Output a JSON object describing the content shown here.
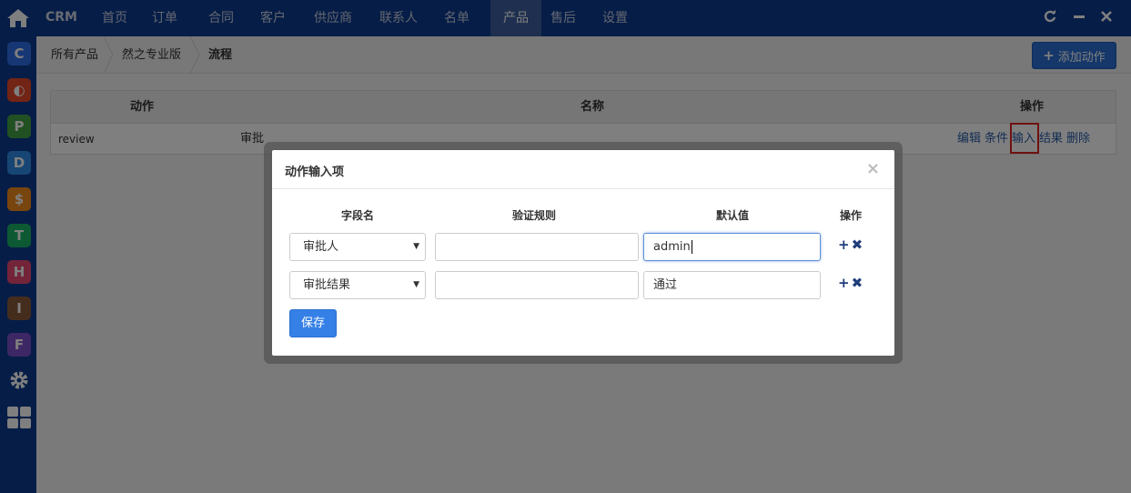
{
  "nav": {
    "brand": "CRM",
    "items": [
      "首页",
      "订单",
      "合同",
      "客户",
      "供应商",
      "联系人",
      "名单",
      "产品",
      "售后",
      "设置"
    ],
    "active_index": 7
  },
  "window_controls": {
    "refresh": "refresh-icon",
    "minimize": "minimize-icon",
    "close": "close-icon"
  },
  "sidebar_apps": [
    {
      "letter": "C",
      "color": "#2f6fe8"
    },
    {
      "letter": "◐",
      "color": "#e5482b"
    },
    {
      "letter": "P",
      "color": "#43a047"
    },
    {
      "letter": "D",
      "color": "#2f8de8"
    },
    {
      "letter": "$",
      "color": "#f08a1c"
    },
    {
      "letter": "T",
      "color": "#18b368"
    },
    {
      "letter": "H",
      "color": "#e84872"
    },
    {
      "letter": "I",
      "color": "#8b5a3c"
    },
    {
      "letter": "F",
      "color": "#7b4fc9"
    }
  ],
  "breadcrumb": [
    "所有产品",
    "然之专业版",
    "流程"
  ],
  "toolbar": {
    "add_action": "添加动作"
  },
  "table": {
    "headers": {
      "action": "动作",
      "name": "名称",
      "ops": "操作"
    },
    "rows": [
      {
        "action": "review",
        "name": "审批",
        "ops": [
          "编辑",
          "条件",
          "输入",
          "结果",
          "删除"
        ]
      }
    ]
  },
  "modal": {
    "title": "动作输入项",
    "close": "×",
    "columns": [
      "字段名",
      "验证规则",
      "默认值",
      "操作"
    ],
    "rows": [
      {
        "field": "审批人",
        "rule": "",
        "default": "admin"
      },
      {
        "field": "审批结果",
        "rule": "",
        "default": "通过"
      }
    ],
    "save": "保存"
  }
}
